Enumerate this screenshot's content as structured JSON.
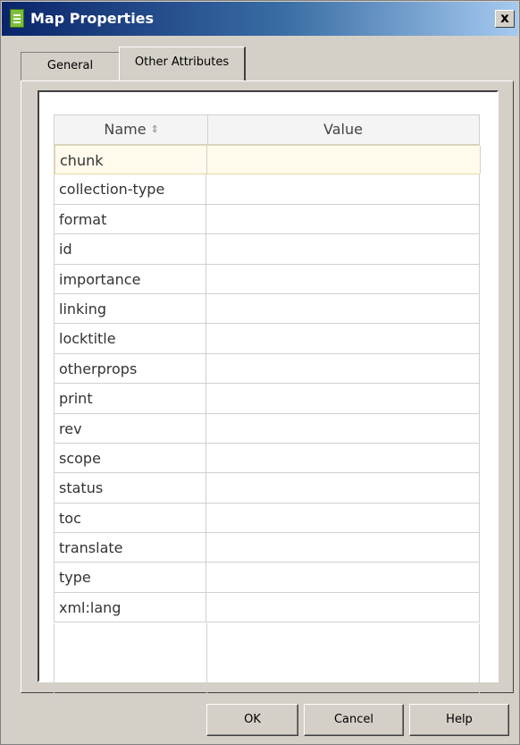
{
  "window": {
    "title": "Map Properties",
    "close_label": "x",
    "icon": "document-icon"
  },
  "tabs": [
    {
      "label": "General",
      "active": false
    },
    {
      "label": "Other Attributes",
      "active": true
    }
  ],
  "table": {
    "columns": [
      {
        "label": "Name",
        "sort_icon": "⇕"
      },
      {
        "label": "Value"
      }
    ],
    "rows": [
      {
        "name": "chunk",
        "value": "",
        "selected": true
      },
      {
        "name": "collection-type",
        "value": ""
      },
      {
        "name": "format",
        "value": ""
      },
      {
        "name": "id",
        "value": ""
      },
      {
        "name": "importance",
        "value": ""
      },
      {
        "name": "linking",
        "value": ""
      },
      {
        "name": "locktitle",
        "value": ""
      },
      {
        "name": "otherprops",
        "value": ""
      },
      {
        "name": "print",
        "value": ""
      },
      {
        "name": "rev",
        "value": ""
      },
      {
        "name": "scope",
        "value": ""
      },
      {
        "name": "status",
        "value": ""
      },
      {
        "name": "toc",
        "value": ""
      },
      {
        "name": "translate",
        "value": ""
      },
      {
        "name": "type",
        "value": ""
      },
      {
        "name": "xml:lang",
        "value": ""
      }
    ]
  },
  "buttons": {
    "ok": "OK",
    "cancel": "Cancel",
    "help": "Help"
  },
  "colors": {
    "title_bar_start": "#0a246a",
    "selected_row": "#fffaeb",
    "dialog_bg": "#d4d0c8"
  }
}
